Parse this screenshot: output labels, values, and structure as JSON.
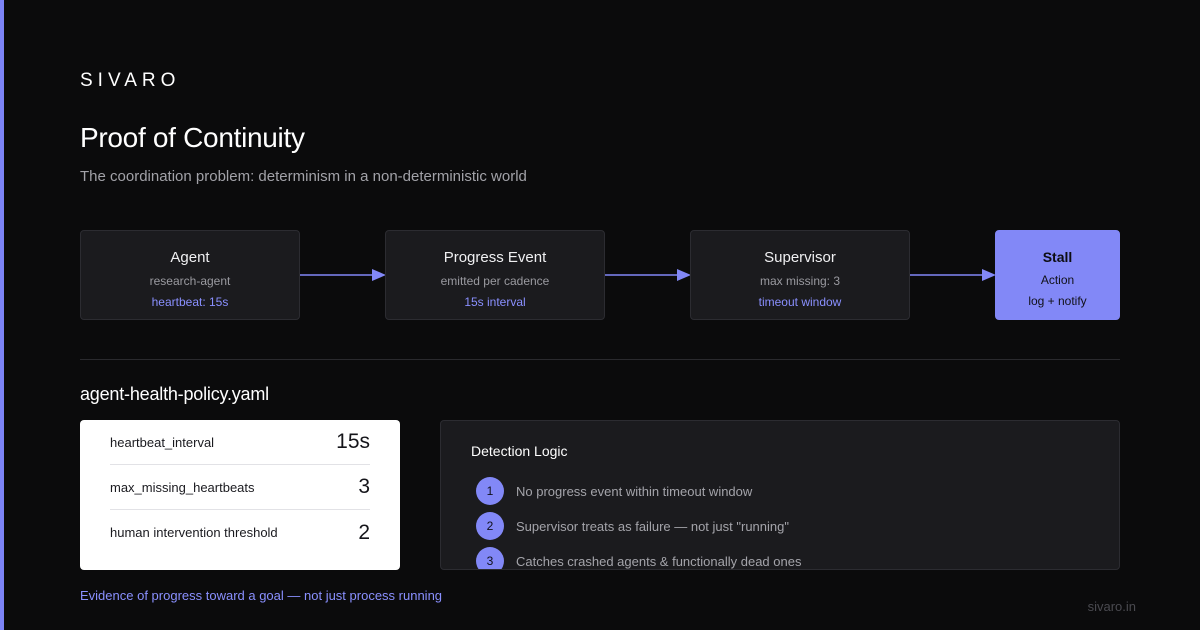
{
  "brand": "SIVARO",
  "title": "Proof of Continuity",
  "subtitle": "The coordination problem: determinism in a non-deterministic world",
  "colors": {
    "background": "#0b0b0c",
    "accent": "#8288f7",
    "card": "#1b1b1e"
  },
  "flow": [
    {
      "name": "Agent",
      "detail": "research-agent",
      "accent": "heartbeat: 15s"
    },
    {
      "name": "Progress Event",
      "detail": "emitted per cadence",
      "accent": "15s interval"
    },
    {
      "name": "Supervisor",
      "detail": "max missing: 3",
      "accent": "timeout window"
    },
    {
      "name": "Stall",
      "detail": "Action",
      "accent": "log + notify"
    }
  ],
  "policy": {
    "title": "agent-health-policy.yaml",
    "params": [
      {
        "key": "heartbeat_interval",
        "value": "15s"
      },
      {
        "key": "max_missing_heartbeats",
        "value": "3"
      },
      {
        "key": "human intervention threshold",
        "value": "2"
      }
    ]
  },
  "logic": {
    "title": "Detection Logic",
    "items": [
      {
        "num": "1",
        "text": "No progress event within timeout window"
      },
      {
        "num": "2",
        "text": "Supervisor treats as failure — not just \"running\""
      },
      {
        "num": "3",
        "text": "Catches crashed agents & functionally dead ones"
      }
    ]
  },
  "footnote": "Evidence of progress toward a goal — not just process running",
  "site": "sivaro.in"
}
